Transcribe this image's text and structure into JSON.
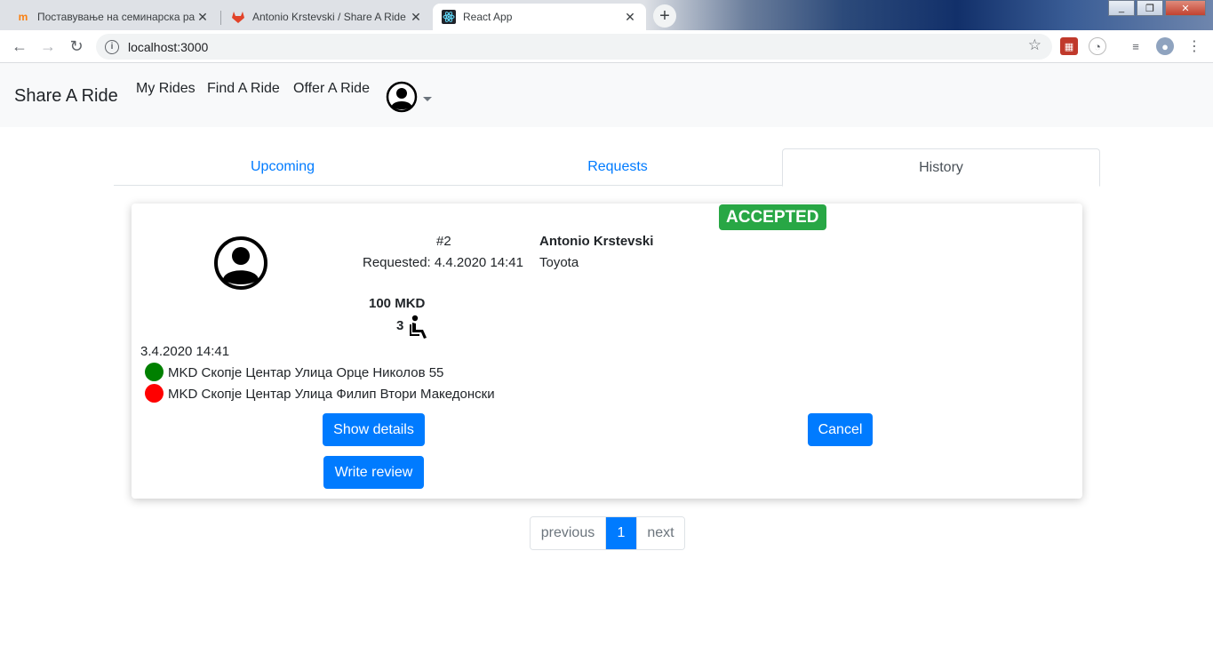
{
  "browser": {
    "tabs": [
      {
        "title": "Поставување на семинарска ра",
        "favicon": "moodle-icon"
      },
      {
        "title": "Antonio Krstevski / Share A Ride",
        "favicon": "gitlab-icon"
      },
      {
        "title": "React App",
        "favicon": "react-icon"
      }
    ],
    "url": "localhost:3000"
  },
  "navbar": {
    "brand": "Share A Ride",
    "links": [
      "My Rides",
      "Find A Ride",
      "Offer A Ride"
    ]
  },
  "tabs": [
    "Upcoming",
    "Requests",
    "History"
  ],
  "active_tab": "History",
  "ride": {
    "status": "ACCEPTED",
    "status_color": "#28a745",
    "number": "#2",
    "requested": "Requested: 4.4.2020 14:41",
    "driver": "Antonio Krstevski",
    "car": "Toyota",
    "price": "100 MKD",
    "seats": "3",
    "date": "3.4.2020 14:41",
    "from": "MKD Скопје Центар Улица Орце Николов 55",
    "to": "MKD Скопје Центар Улица Филип Втори Македонски",
    "from_color": "#008000",
    "to_color": "#ff0000",
    "show_details": "Show details",
    "write_review": "Write review",
    "cancel": "Cancel"
  },
  "pagination": {
    "previous": "previous",
    "current": "1",
    "next": "next"
  },
  "colors": {
    "primary": "#007bff",
    "success": "#28a745"
  }
}
